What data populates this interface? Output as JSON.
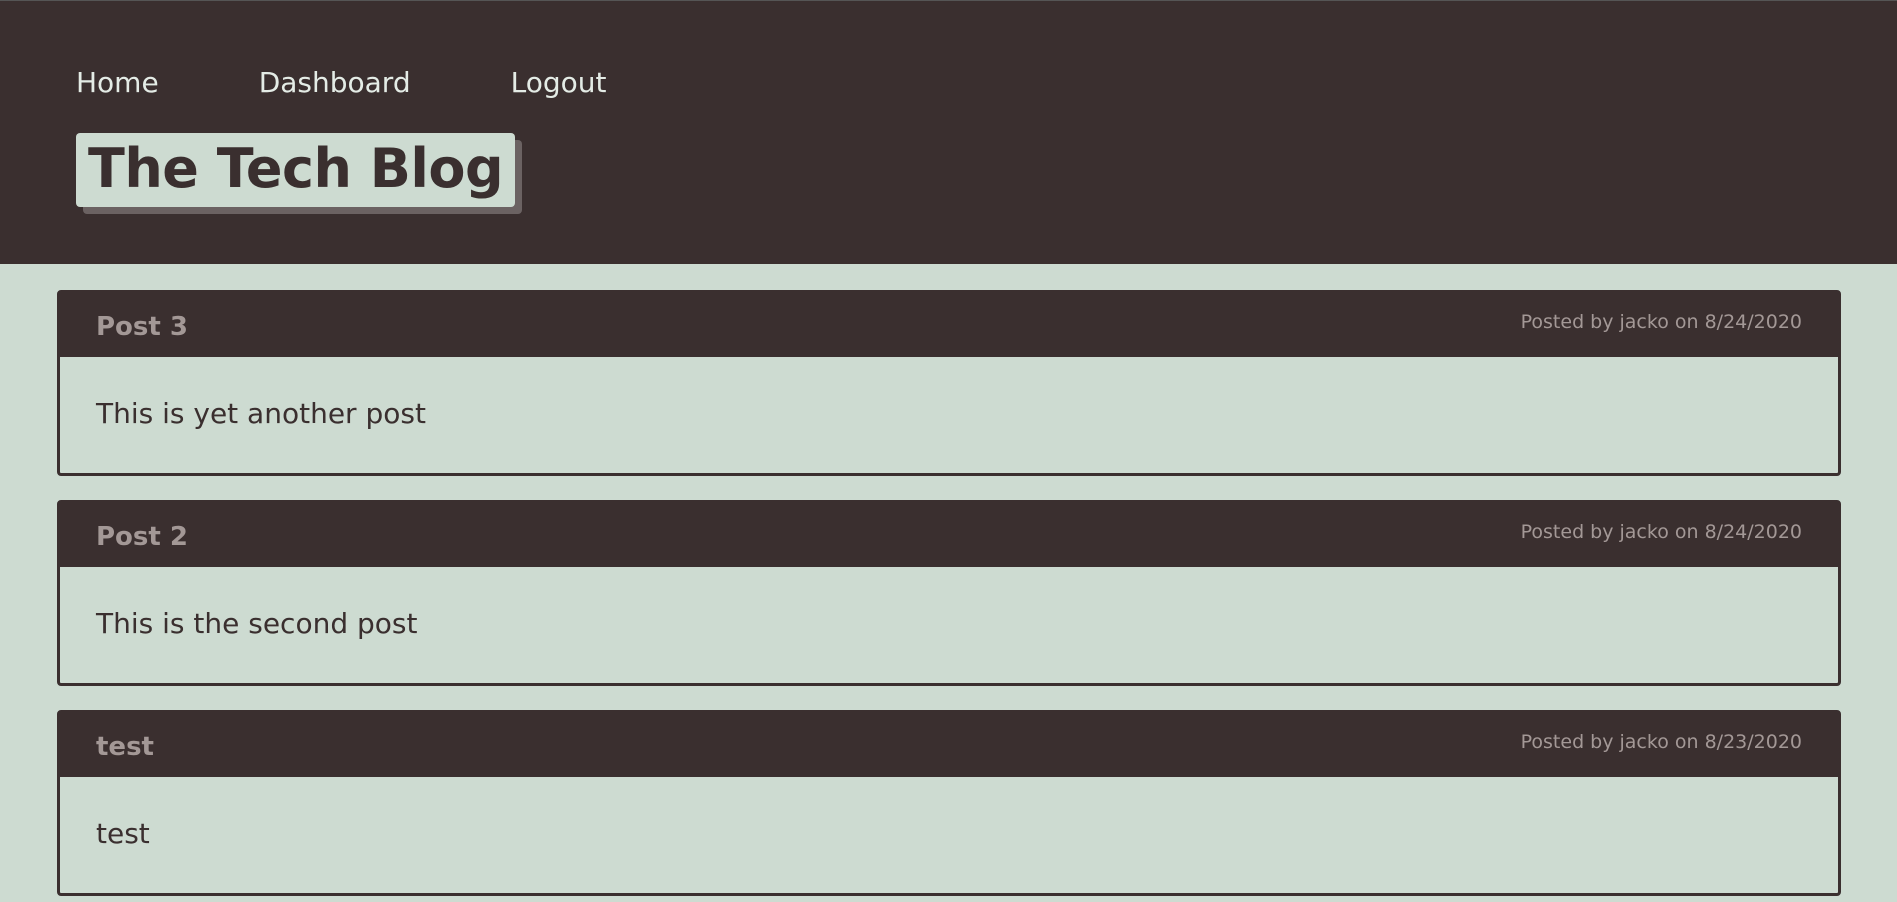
{
  "nav": {
    "home": "Home",
    "dashboard": "Dashboard",
    "logout": "Logout"
  },
  "brand": {
    "title": "The Tech Blog"
  },
  "posts": [
    {
      "title": "Post 3",
      "meta": "Posted by jacko on 8/24/2020",
      "body": "This is yet another post"
    },
    {
      "title": "Post 2",
      "meta": "Posted by jacko on 8/24/2020",
      "body": "This is the second post"
    },
    {
      "title": "test",
      "meta": "Posted by jacko on 8/23/2020",
      "body": "test"
    }
  ],
  "colors": {
    "header_bg": "#3a2f2f",
    "page_bg": "#cddbd1",
    "muted_text": "#a39896",
    "nav_text": "#e4ece6"
  }
}
